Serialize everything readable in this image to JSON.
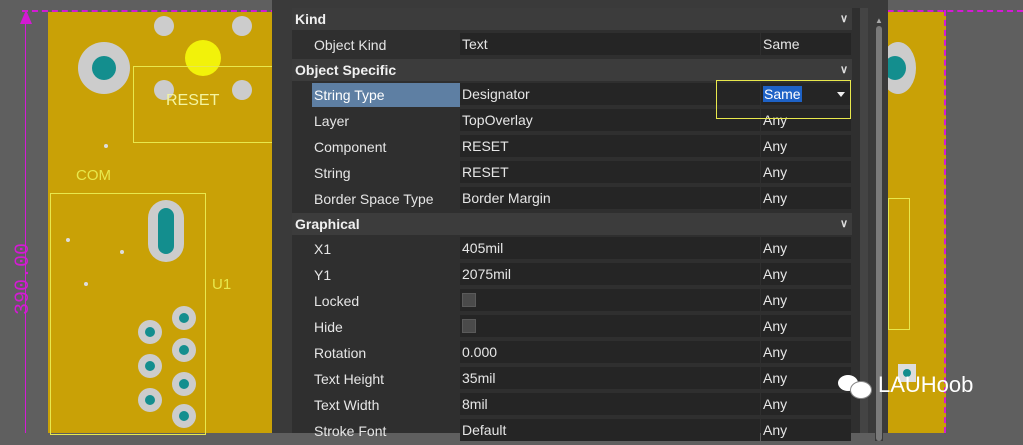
{
  "pcb": {
    "silk_reset": "RESET",
    "silk_com": "COM",
    "silk_u1": "U1",
    "dimension_text": "390.00"
  },
  "panel": {
    "sections": [
      {
        "title": "Kind"
      },
      {
        "title": "Object Specific"
      },
      {
        "title": "Graphical"
      }
    ],
    "kind_rows": [
      {
        "label": "Object Kind",
        "value": "Text",
        "mode": "Same"
      }
    ],
    "object_specific_rows": [
      {
        "label": "String Type",
        "value": "Designator",
        "mode": "Same"
      },
      {
        "label": "Layer",
        "value": "TopOverlay",
        "mode": "Any"
      },
      {
        "label": "Component",
        "value": "RESET",
        "mode": "Any"
      },
      {
        "label": "String",
        "value": "RESET",
        "mode": "Any"
      },
      {
        "label": "Border Space Type",
        "value": "Border Margin",
        "mode": "Any"
      }
    ],
    "graphical_rows": [
      {
        "label": "X1",
        "value": "405mil",
        "mode": "Any"
      },
      {
        "label": "Y1",
        "value": "2075mil",
        "mode": "Any"
      },
      {
        "label": "Locked",
        "value": "",
        "mode": "Any"
      },
      {
        "label": "Hide",
        "value": "",
        "mode": "Any"
      },
      {
        "label": "Rotation",
        "value": "0.000",
        "mode": "Any"
      },
      {
        "label": "Text Height",
        "value": "35mil",
        "mode": "Any"
      },
      {
        "label": "Text Width",
        "value": "8mil",
        "mode": "Any"
      },
      {
        "label": "Stroke Font",
        "value": "Default",
        "mode": "Any"
      }
    ]
  },
  "watermark": {
    "text": "LAUHoob"
  },
  "colors": {
    "selection": "#5e7fa3",
    "highlight": "#1e62c6",
    "board": "#c9a106",
    "silkscreen": "#e8e84c",
    "edge": "#d41ad4"
  }
}
